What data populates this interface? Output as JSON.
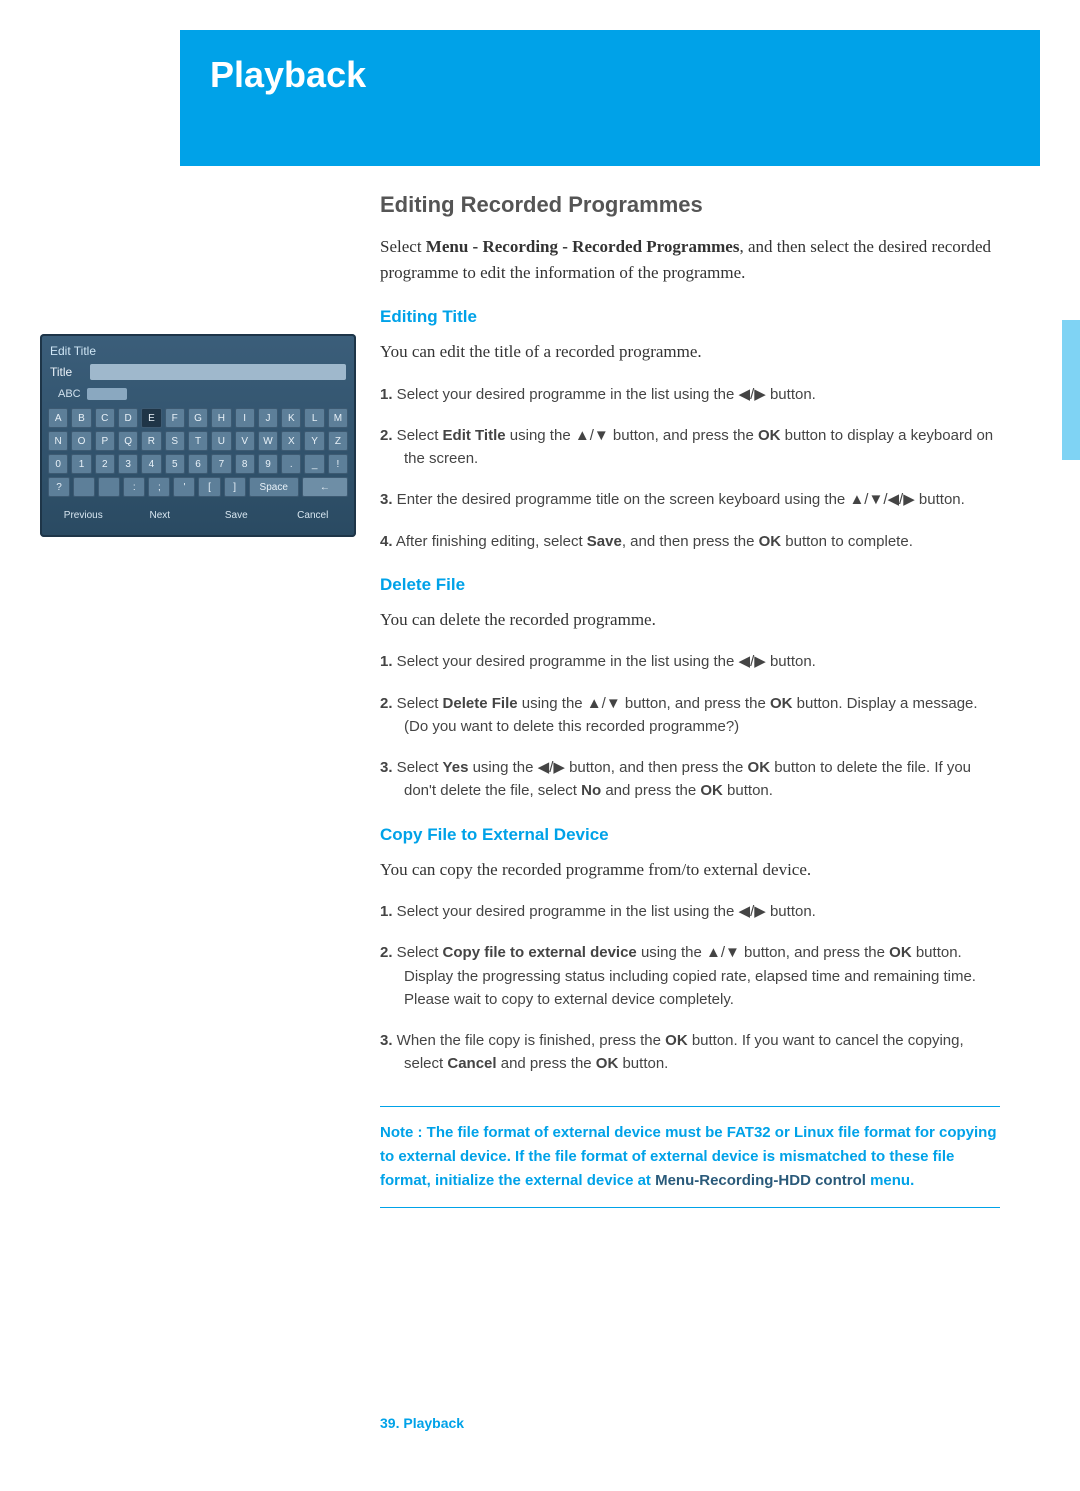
{
  "banner_title": "Playback",
  "section_title": "Editing Recorded Programmes",
  "intro_html": "Select <b>Menu - Recording - Recorded Programmes</b>, and then select the desired recorded programme to edit the information of the programme.",
  "sub1": {
    "title": "Editing Title",
    "body": "You can edit the title of a recorded programme.",
    "steps": [
      "<b>1.</b> Select your desired programme in the list using the <span class='glyph'>◀</span>/<span class='glyph'>▶</span> button.",
      "<b>2.</b> Select <b>Edit Title</b> using the <span class='glyph'>▲</span>/<span class='glyph'>▼</span> button, and press the <b>OK</b> button to display a keyboard on the screen.",
      "<b>3.</b> Enter the desired programme title on the screen keyboard using the <span class='glyph'>▲</span>/<span class='glyph'>▼</span>/<span class='glyph'>◀</span>/<span class='glyph'>▶</span> button.",
      "<b>4.</b> After finishing editing, select <b>Save</b>, and then press the <b>OK</b> button to complete."
    ]
  },
  "sub2": {
    "title": "Delete File",
    "body": "You can delete the recorded programme.",
    "steps": [
      "<b>1.</b> Select your desired programme in the list using the <span class='glyph'>◀</span>/<span class='glyph'>▶</span> button.",
      "<b>2.</b> Select <b>Delete File</b> using the <span class='glyph'>▲</span>/<span class='glyph'>▼</span>  button, and press the <b>OK</b> button. Display a message. (Do you want to delete this recorded programme?)",
      "<b>3.</b> Select <b>Yes</b> using the <span class='glyph'>◀</span>/<span class='glyph'>▶</span> button, and then press the <b>OK</b> button to delete the file. If you don't delete the file, select <b>No</b> and press the <b>OK</b> button."
    ]
  },
  "sub3": {
    "title": "Copy File to External Device",
    "body": "You can copy the recorded programme from/to external device.",
    "steps": [
      "<b>1.</b> Select your desired programme in the list using the <span class='glyph'>◀</span>/<span class='glyph'>▶</span> button.",
      "<b>2.</b> Select <b>Copy file to external device</b> using the <span class='glyph'>▲</span>/<span class='glyph'>▼</span> button, and press the <b>OK</b> button. Display the progressing status including copied rate, elapsed time and remaining time. Please wait to copy to external device completely.",
      "<b>3.</b> When the file copy is finished, press the <b>OK</b> button. If you want to cancel the copying, select <b>Cancel</b> and press the <b>OK</b> button."
    ]
  },
  "note_html": "Note : The file format of external device must be FAT32 or Linux file format for copying to external device. If the file format of external device is mismatched to these file format, initialize the external device at <span class='dark'>Menu-Recording-HDD control</span> menu.",
  "footer": "39. Playback",
  "mock": {
    "window_title": "Edit Title",
    "field_label": "Title",
    "sub_label": "ABC",
    "rows": [
      [
        "A",
        "B",
        "C",
        "D",
        "E",
        "F",
        "G",
        "H",
        "I",
        "J",
        "K",
        "L",
        "M"
      ],
      [
        "N",
        "O",
        "P",
        "Q",
        "R",
        "S",
        "T",
        "U",
        "V",
        "W",
        "X",
        "Y",
        "Z"
      ],
      [
        "0",
        "1",
        "2",
        "3",
        "4",
        "5",
        "6",
        "7",
        "8",
        "9",
        ".",
        "_",
        "!"
      ],
      [
        "?",
        " ",
        " ",
        ":",
        ";",
        "'",
        "[",
        "]",
        "Space",
        "←"
      ]
    ],
    "selected_key": "E",
    "buttons": [
      "Previous",
      "Next",
      "Save",
      "Cancel"
    ]
  }
}
